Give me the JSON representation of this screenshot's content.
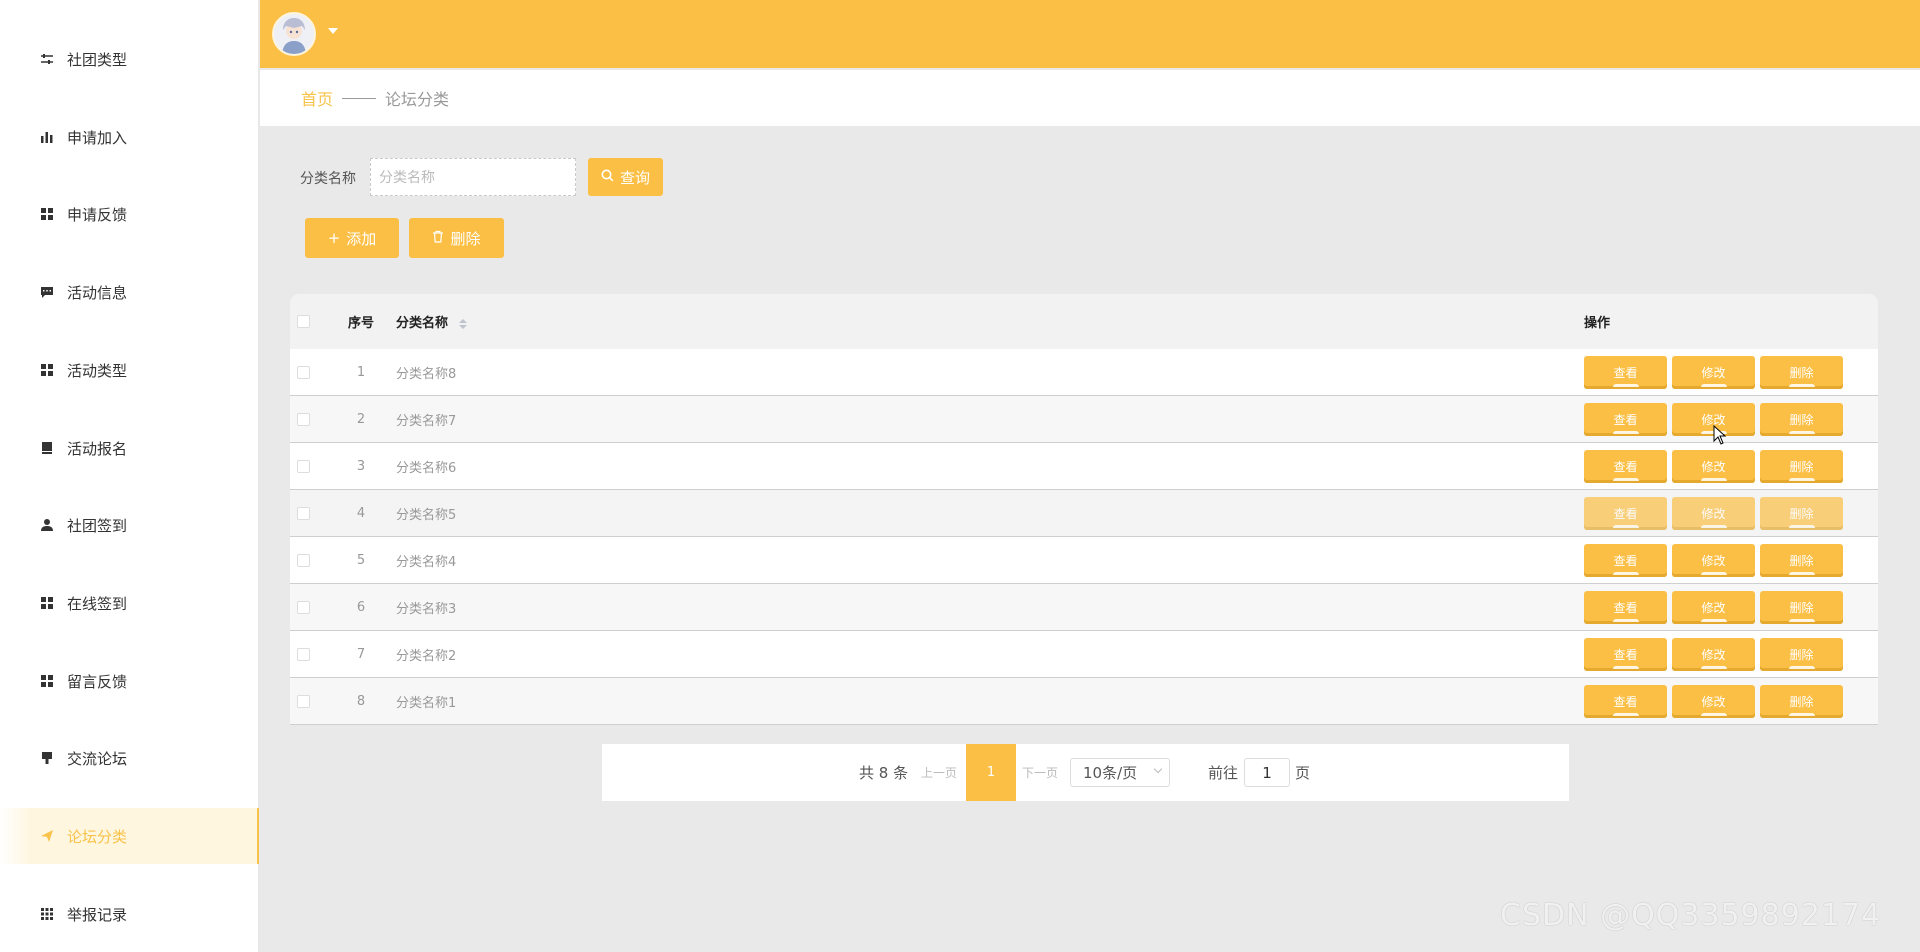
{
  "sidebar": {
    "items": [
      {
        "label": "社团类型",
        "icon": "sliders-icon"
      },
      {
        "label": "申请加入",
        "icon": "bar-chart-icon"
      },
      {
        "label": "申请反馈",
        "icon": "grid-icon"
      },
      {
        "label": "活动信息",
        "icon": "message-icon"
      },
      {
        "label": "活动类型",
        "icon": "grid-icon"
      },
      {
        "label": "活动报名",
        "icon": "book-icon"
      },
      {
        "label": "社团签到",
        "icon": "user-icon"
      },
      {
        "label": "在线签到",
        "icon": "grid-icon"
      },
      {
        "label": "留言反馈",
        "icon": "grid-icon"
      },
      {
        "label": "交流论坛",
        "icon": "brush-icon"
      },
      {
        "label": "论坛分类",
        "icon": "send-icon",
        "active": true
      },
      {
        "label": "举报记录",
        "icon": "apps-icon"
      }
    ]
  },
  "breadcrumb": {
    "home": "首页",
    "current": "论坛分类"
  },
  "search": {
    "label": "分类名称",
    "placeholder": "分类名称",
    "button": "查询"
  },
  "actions": {
    "add": "添加",
    "delete": "删除"
  },
  "table": {
    "headers": {
      "seq": "序号",
      "name": "分类名称",
      "ops": "操作"
    },
    "op_labels": {
      "view": "查看",
      "edit": "修改",
      "delete": "删除"
    },
    "rows": [
      {
        "seq": "1",
        "name": "分类名称8"
      },
      {
        "seq": "2",
        "name": "分类名称7"
      },
      {
        "seq": "3",
        "name": "分类名称6"
      },
      {
        "seq": "4",
        "name": "分类名称5"
      },
      {
        "seq": "5",
        "name": "分类名称4"
      },
      {
        "seq": "6",
        "name": "分类名称3"
      },
      {
        "seq": "7",
        "name": "分类名称2"
      },
      {
        "seq": "8",
        "name": "分类名称1"
      }
    ]
  },
  "pagination": {
    "total": "共 8 条",
    "prev": "上一页",
    "current": "1",
    "next": "下一页",
    "page_size": "10条/页",
    "goto": "前往",
    "goto_value": "1",
    "page_suffix": "页"
  },
  "watermark": "CSDN @QQ3359892174",
  "colors": {
    "accent": "#fcbf45"
  }
}
